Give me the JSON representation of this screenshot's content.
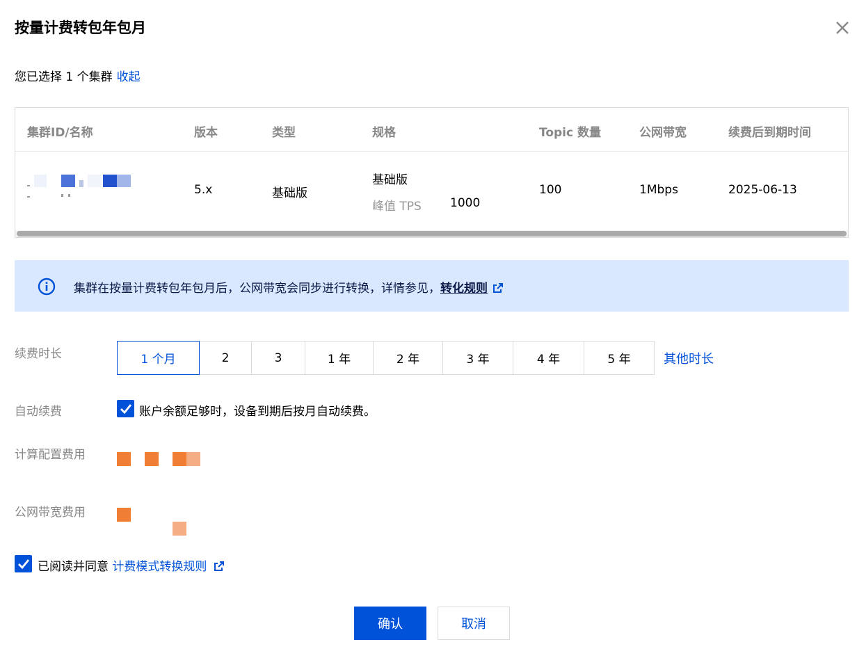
{
  "dialog": {
    "title": "按量计费转包年包月",
    "close_icon": "close-icon"
  },
  "selection": {
    "text": "您已选择 1 个集群",
    "collapse_label": "收起"
  },
  "table": {
    "headers": [
      "集群ID/名称",
      "版本",
      "类型",
      "规格",
      "Topic 数量",
      "公网带宽",
      "续费后到期时间"
    ],
    "row": {
      "version": "5.x",
      "type": "基础版",
      "spec_name": "基础版",
      "spec_tps_label": "峰值 TPS",
      "spec_tps_value": "1000",
      "topic_count": "100",
      "bandwidth": "1Mbps",
      "expire_date": "2025-06-13"
    }
  },
  "alert": {
    "icon": "info-circle-icon",
    "text": "集群在按量计费转包年包月后，公网带宽会同步进行转换，详情参见，",
    "link_label": "转化规则"
  },
  "renewal": {
    "label": "续费时长",
    "options": [
      "1 个月",
      "2",
      "3",
      "1 年",
      "2 年",
      "3 年",
      "4 年",
      "5 年"
    ],
    "selected": "1 个月",
    "other_label": "其他时长"
  },
  "auto_renew": {
    "label": "自动续费",
    "checked": true,
    "text": "账户余额足够时，设备到期后按月自动续费。"
  },
  "compute_fee": {
    "label": "计算配置费用"
  },
  "bandwidth_fee": {
    "label": "公网带宽费用"
  },
  "agreement": {
    "checked": true,
    "text": "已阅读并同意",
    "link_label": "计费模式转换规则"
  },
  "actions": {
    "confirm_label": "确认",
    "cancel_label": "取消"
  },
  "colors": {
    "primary": "#0052d9",
    "alert_bg": "#d9e7ff",
    "price_blur": "#f07f35"
  }
}
